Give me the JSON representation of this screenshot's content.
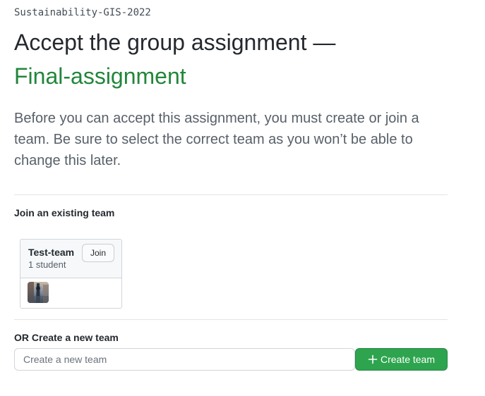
{
  "header": {
    "org_name": "Sustainability-GIS-2022",
    "title_prefix": "Accept the group assignment —",
    "assignment_name": "Final-assignment"
  },
  "intro": {
    "text": "Before you can accept this assignment, you must create or join a team. Be sure to select the correct team as you won’t be able to change this later."
  },
  "join_section": {
    "label": "Join an existing team",
    "teams": [
      {
        "name": "Test-team",
        "count": "1 student",
        "join_label": "Join",
        "avatar_icon": "user-avatar-photo"
      }
    ]
  },
  "create_section": {
    "label": "OR Create a new team",
    "input_placeholder": "Create a new team",
    "input_value": "",
    "button_label": "Create team",
    "button_icon": "plus-icon"
  },
  "colors": {
    "assignment_green": "#22863a",
    "primary_button": "#2ea44f"
  }
}
